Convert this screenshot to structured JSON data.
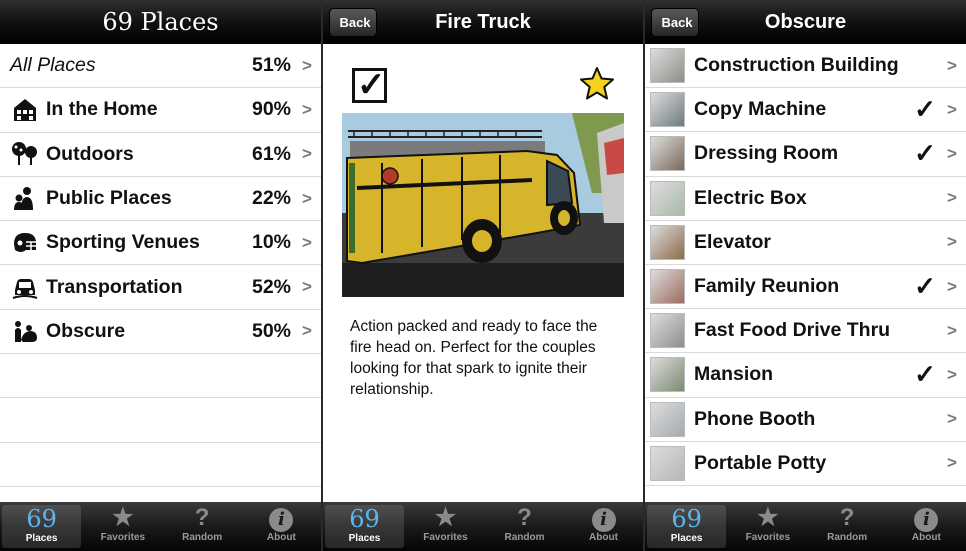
{
  "panel1": {
    "title": "69 Places",
    "rows": [
      {
        "label": "All Places",
        "percent": "51%",
        "icon": "none"
      },
      {
        "label": "In the Home",
        "percent": "90%",
        "icon": "house-icon"
      },
      {
        "label": "Outdoors",
        "percent": "61%",
        "icon": "trees-icon"
      },
      {
        "label": "Public Places",
        "percent": "22%",
        "icon": "people-icon"
      },
      {
        "label": "Sporting Venues",
        "percent": "10%",
        "icon": "football-helmet-icon"
      },
      {
        "label": "Transportation",
        "percent": "52%",
        "icon": "car-icon"
      },
      {
        "label": "Obscure",
        "percent": "50%",
        "icon": "obscure-icon"
      }
    ]
  },
  "panel2": {
    "back_label": "Back",
    "title": "Fire Truck",
    "checked": true,
    "favorite": true,
    "description": "Action packed and ready to face the fire head on. Perfect for the couples looking for that spark to ignite their relationship."
  },
  "panel3": {
    "back_label": "Back",
    "title": "Obscure",
    "rows": [
      {
        "label": "Construction Building",
        "checked": false,
        "thumb_color": "#8b8f86"
      },
      {
        "label": "Copy Machine",
        "checked": true,
        "thumb_color": "#6e7a80"
      },
      {
        "label": "Dressing Room",
        "checked": true,
        "thumb_color": "#7a6a5a"
      },
      {
        "label": "Electric Box",
        "checked": false,
        "thumb_color": "#a9b9a8"
      },
      {
        "label": "Elevator",
        "checked": false,
        "thumb_color": "#8c6b4a"
      },
      {
        "label": "Family Reunion",
        "checked": true,
        "thumb_color": "#9a6d5e"
      },
      {
        "label": "Fast Food Drive Thru",
        "checked": false,
        "thumb_color": "#8e8e8e"
      },
      {
        "label": "Mansion",
        "checked": true,
        "thumb_color": "#7b8a70"
      },
      {
        "label": "Phone Booth",
        "checked": false,
        "thumb_color": "#a3aab0"
      },
      {
        "label": "Portable Potty",
        "checked": false,
        "thumb_color": "#b6b6b6"
      }
    ]
  },
  "tabbar": {
    "tabs": [
      {
        "label": "Places",
        "icon_text": "69"
      },
      {
        "label": "Favorites",
        "icon_text": "★"
      },
      {
        "label": "Random",
        "icon_text": "?"
      },
      {
        "label": "About",
        "icon_text": "i"
      }
    ]
  },
  "colors": {
    "navbar": "#121212",
    "active_tab_icon": "#5fb4f0",
    "star_fill": "#f6d21c",
    "truck_yellow": "#d7b52a"
  }
}
